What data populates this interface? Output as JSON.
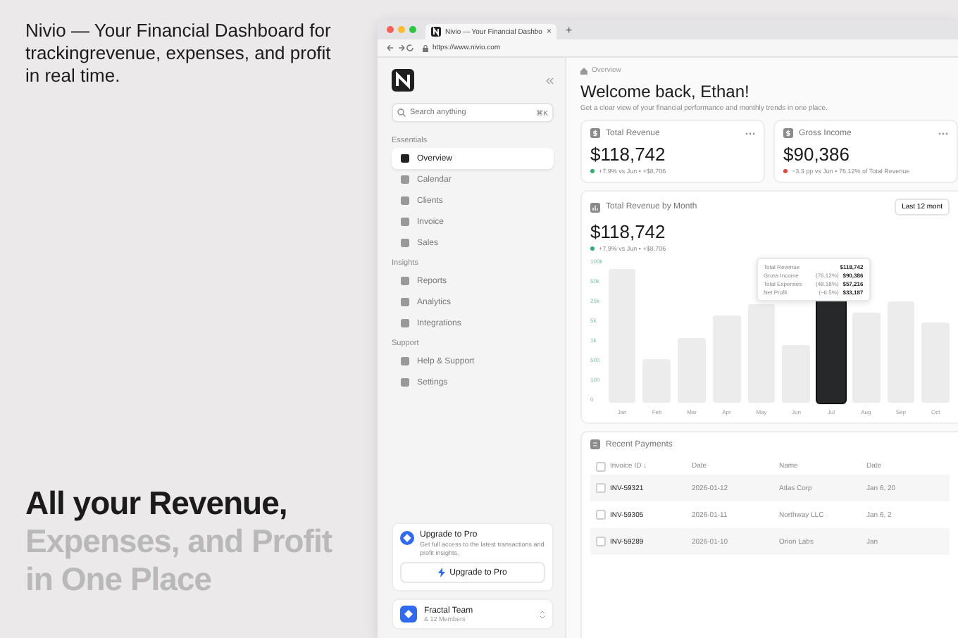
{
  "promo": {
    "tagline": "Nivio — Your Financial Dashboard for trackingrevenue, expenses, and profit in real time.",
    "headline": [
      {
        "text": "All your Revenue,",
        "muted": false
      },
      {
        "text": "Expenses, and Profit",
        "muted": true
      },
      {
        "text": "in One Place",
        "muted": true
      }
    ]
  },
  "browser": {
    "tab_title": "Nivio — Your Financial Dashbo",
    "tab_close": "×",
    "new_tab": "+",
    "url": "https://www.nivio.com"
  },
  "sidebar": {
    "search": {
      "placeholder": "Search anything",
      "shortcut": "⌘K"
    },
    "sections": [
      {
        "title": "Essentials",
        "items": [
          {
            "label": "Overview",
            "selected": true
          },
          {
            "label": "Calendar",
            "selected": false
          },
          {
            "label": "Clients",
            "selected": false
          },
          {
            "label": "Invoice",
            "selected": false
          },
          {
            "label": "Sales",
            "selected": false
          }
        ]
      },
      {
        "title": "Insights",
        "items": [
          {
            "label": "Reports",
            "selected": false
          },
          {
            "label": "Analytics",
            "selected": false
          },
          {
            "label": "Integrations",
            "selected": false
          }
        ]
      },
      {
        "title": "Support",
        "items": [
          {
            "label": "Help & Support",
            "selected": false
          },
          {
            "label": "Settings",
            "selected": false
          }
        ]
      }
    ],
    "upgrade": {
      "title": "Upgrade to Pro",
      "text": "Get full access to the latest transactions and profit insights.",
      "button": "Upgrade to Pro"
    },
    "team": {
      "name": "Fractal Team",
      "members": "& 12 Members"
    }
  },
  "main": {
    "breadcrumb": "Overview",
    "title": "Welcome back, Ethan!",
    "subtitle": "Get a clear view of your financial performance and monthly trends in one place.",
    "metrics": [
      {
        "label": "Total Revenue",
        "value": "$118,742",
        "color": "#2fae6e",
        "change": "+7.9% vs Jun • +$8,706"
      },
      {
        "label": "Gross Income",
        "value": "$90,386",
        "color": "#e0483e",
        "change": "−3.3 pp vs Jun • 76.12% of Total Revenue"
      }
    ],
    "revenue_chart": {
      "title": "Total Revenue by Month",
      "range_button": "Last 12 mont",
      "value": "$118,742",
      "change": "+7.9% vs Jun • +$8,706",
      "yticks": [
        "100k",
        "50k",
        "25k",
        "5k",
        "1k",
        "500",
        "100",
        "0"
      ],
      "months": [
        {
          "label": "Jan",
          "selected": false
        },
        {
          "label": "Feb",
          "selected": false
        },
        {
          "label": "Mar",
          "selected": false
        },
        {
          "label": "Apr",
          "selected": false
        },
        {
          "label": "May",
          "selected": false
        },
        {
          "label": "Jun",
          "selected": false
        },
        {
          "label": "Jul",
          "selected": true
        },
        {
          "label": "Aug",
          "selected": false
        },
        {
          "label": "Sep",
          "selected": false
        },
        {
          "label": "Oct",
          "selected": false
        }
      ],
      "tooltip": [
        {
          "label": "Total Revenue",
          "value": "$118,742"
        },
        {
          "label": "Gross Income",
          "share": "(76.12%)",
          "value": "$90,386"
        },
        {
          "label": "Total Expenses",
          "share": "(48.18%)",
          "value": "$57,216"
        },
        {
          "label": "Net Profit",
          "share": "(−6.5%)",
          "value": "$33,187"
        }
      ]
    },
    "payments": {
      "title": "Recent Payments",
      "header_checked": false,
      "columns": [
        "Invoice ID ↓",
        "Date",
        "Name",
        "Date"
      ],
      "rows": [
        {
          "checked": false,
          "cells": [
            "INV-59321",
            "2026-01-12",
            "Atlas Corp",
            "Jan 6, 20"
          ]
        },
        {
          "checked": false,
          "cells": [
            "INV-59305",
            "2026-01-11",
            "Northway LLC",
            "Jan 6, 2"
          ]
        },
        {
          "checked": false,
          "cells": [
            "INV-59289",
            "2026-01-10",
            "Orion Labs",
            "Jan"
          ]
        }
      ]
    }
  }
}
